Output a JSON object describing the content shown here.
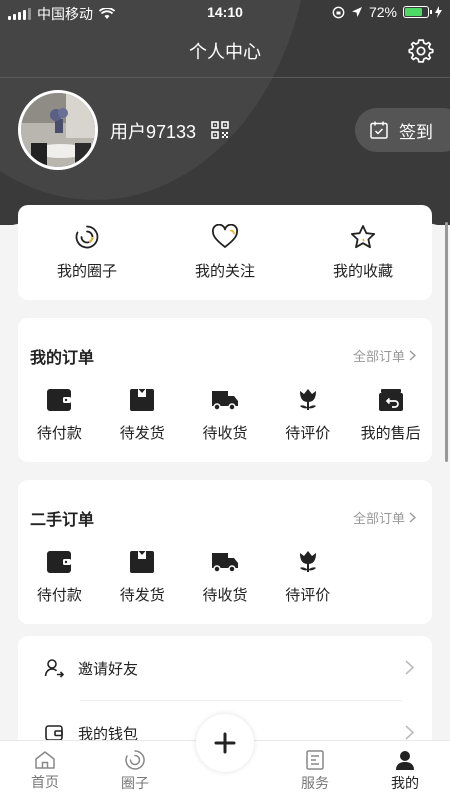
{
  "status_bar": {
    "carrier": "中国移动",
    "time": "14:10",
    "battery": "72%",
    "battery_level": 0.72
  },
  "nav": {
    "title": "个人中心"
  },
  "profile": {
    "username": "用户97133",
    "checkin_label": "签到"
  },
  "quick_links": [
    {
      "label": "我的圈子",
      "icon": "circle-refresh-icon"
    },
    {
      "label": "我的关注",
      "icon": "heart-icon"
    },
    {
      "label": "我的收藏",
      "icon": "star-icon"
    }
  ],
  "orders": {
    "title": "我的订单",
    "more": "全部订单",
    "items": [
      {
        "label": "待付款",
        "icon": "wallet-icon"
      },
      {
        "label": "待发货",
        "icon": "box-icon"
      },
      {
        "label": "待收货",
        "icon": "truck-icon"
      },
      {
        "label": "待评价",
        "icon": "flower-icon"
      },
      {
        "label": "我的售后",
        "icon": "return-box-icon"
      }
    ]
  },
  "secondhand_orders": {
    "title": "二手订单",
    "more": "全部订单",
    "items": [
      {
        "label": "待付款",
        "icon": "wallet-icon"
      },
      {
        "label": "待发货",
        "icon": "box-icon"
      },
      {
        "label": "待收货",
        "icon": "truck-icon"
      },
      {
        "label": "待评价",
        "icon": "flower-icon"
      }
    ]
  },
  "menu": [
    {
      "label": "邀请好友",
      "icon": "user-invite-icon"
    },
    {
      "label": "我的钱包",
      "icon": "wallet-outline-icon"
    }
  ],
  "tabbar": [
    {
      "label": "首页",
      "icon": "home-icon"
    },
    {
      "label": "圈子",
      "icon": "circle-icon"
    },
    {
      "label": "服务",
      "icon": "service-icon"
    },
    {
      "label": "我的",
      "icon": "user-icon"
    }
  ]
}
